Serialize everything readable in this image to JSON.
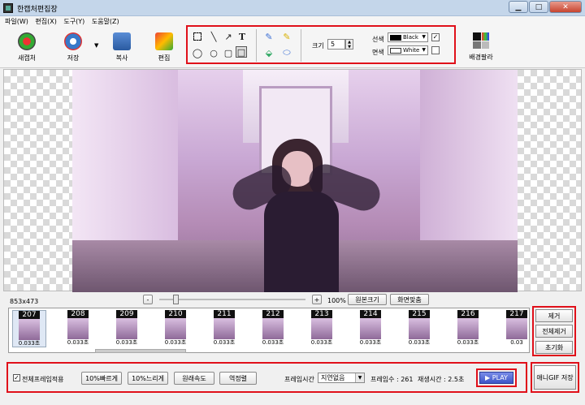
{
  "window": {
    "title": "한캡처편집장"
  },
  "menu": [
    "파일(W)",
    "편집(X)",
    "도구(Y)",
    "도움말(Z)"
  ],
  "toolbar": {
    "new_capture": "새캡처",
    "save": "저장",
    "copy": "복사",
    "edit": "편집",
    "bg_palette": "배경팔라"
  },
  "draw_tools": {
    "size_label": "크기",
    "size_value": "5",
    "line_label": "선색",
    "line_color_name": "Black",
    "fill_label": "면색",
    "fill_color_name": "White",
    "line_checked": true,
    "fill_checked": false
  },
  "image": {
    "dimensions": "853x473"
  },
  "zoom": {
    "minus": "-",
    "plus": "+",
    "percent": "100%",
    "original_size": "원본크기",
    "fit_screen": "화면맞춤"
  },
  "frames": [
    {
      "num": "207",
      "dur": "0.033초"
    },
    {
      "num": "208",
      "dur": "0.033초"
    },
    {
      "num": "209",
      "dur": "0.033초"
    },
    {
      "num": "210",
      "dur": "0.033초"
    },
    {
      "num": "211",
      "dur": "0.033초"
    },
    {
      "num": "212",
      "dur": "0.033초"
    },
    {
      "num": "213",
      "dur": "0.033초"
    },
    {
      "num": "214",
      "dur": "0.033초"
    },
    {
      "num": "215",
      "dur": "0.033초"
    },
    {
      "num": "216",
      "dur": "0.033초"
    },
    {
      "num": "217",
      "dur": "0.03"
    }
  ],
  "side": {
    "remove": "제거",
    "remove_all": "전체제거",
    "reset": "초기화",
    "save_gif": "애니GIF 저장"
  },
  "bottom": {
    "apply_all": "전체프레임적용",
    "faster": "10%빠르게",
    "slower": "10%느리게",
    "original_speed": "원래속도",
    "reverse": "역정렬",
    "frame_time_label": "프레임시간",
    "frame_time_value": "지연없음",
    "frame_count": "프레임수 : 261",
    "play_time": "재생시간 : 2.5초",
    "play": "▶ PLAY"
  }
}
